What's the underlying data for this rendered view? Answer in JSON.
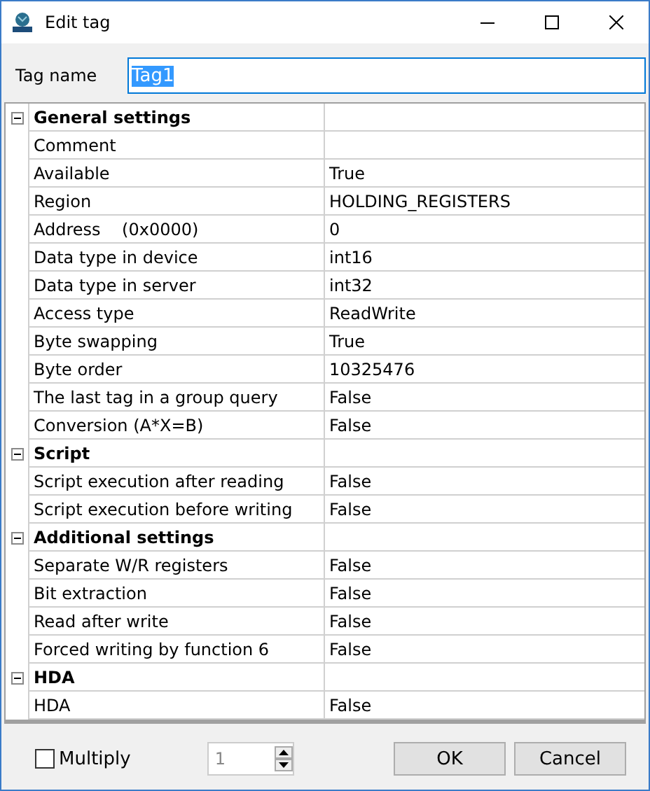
{
  "window": {
    "title": "Edit tag"
  },
  "tag_name": {
    "label": "Tag name",
    "value": "Tag1"
  },
  "groups": [
    {
      "title": "General settings",
      "expanded": true,
      "rows": [
        {
          "name": "Comment",
          "value": ""
        },
        {
          "name": "Available",
          "value": "True"
        },
        {
          "name": "Region",
          "value": "HOLDING_REGISTERS"
        },
        {
          "name": "Address    (0x0000)",
          "value": "0"
        },
        {
          "name": "Data type in device",
          "value": "int16"
        },
        {
          "name": "Data type in server",
          "value": "int32"
        },
        {
          "name": "Access type",
          "value": "ReadWrite"
        },
        {
          "name": "Byte swapping",
          "value": "True"
        },
        {
          "name": "Byte order",
          "value": "10325476"
        },
        {
          "name": "The last tag in a group query",
          "value": "False"
        },
        {
          "name": "Conversion (A*X=B)",
          "value": "False"
        }
      ]
    },
    {
      "title": "Script",
      "expanded": true,
      "rows": [
        {
          "name": "Script execution after reading",
          "value": "False"
        },
        {
          "name": "Script execution before writing",
          "value": "False"
        }
      ]
    },
    {
      "title": "Additional settings",
      "expanded": true,
      "rows": [
        {
          "name": "Separate W/R registers",
          "value": "False"
        },
        {
          "name": "Bit extraction",
          "value": "False"
        },
        {
          "name": "Read after write",
          "value": "False"
        },
        {
          "name": "Forced writing by function 6",
          "value": "False"
        }
      ]
    },
    {
      "title": "HDA",
      "expanded": true,
      "rows": [
        {
          "name": "HDA",
          "value": "False"
        }
      ]
    }
  ],
  "multiply": {
    "label": "Multiply",
    "checked": false
  },
  "spinner": {
    "value": "1",
    "disabled": true
  },
  "buttons": [
    "OK",
    "Cancel"
  ]
}
